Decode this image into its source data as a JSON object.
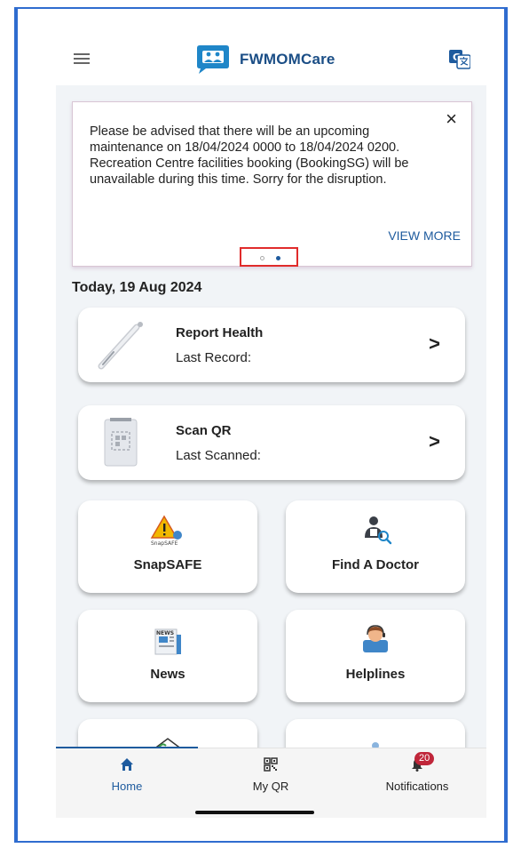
{
  "app": {
    "title": "FWMOMCare"
  },
  "banner": {
    "message": "Please be advised that there will be an upcoming maintenance on 18/04/2024 0000 to 18/04/2024 0200. Recreation Centre facilities booking (BookingSG) will be unavailable during this time. Sorry for the disruption.",
    "close_label": "×",
    "view_more": "VIEW MORE",
    "page_count": 2,
    "active_page": 2
  },
  "date": "Today, 19 Aug 2024",
  "cards": {
    "report_health": {
      "title": "Report Health",
      "subtitle": "Last Record:",
      "icon": "thermometer-icon"
    },
    "scan_qr": {
      "title": "Scan QR",
      "subtitle": "Last Scanned:",
      "icon": "qr-scanner-icon"
    }
  },
  "tiles": {
    "snapsafe": {
      "label": "SnapSAFE",
      "icon_caption": "SnapSAFE",
      "icon": "warning-icon"
    },
    "find_doctor": {
      "label": "Find A Doctor",
      "icon": "doctor-search-icon"
    },
    "news": {
      "label": "News",
      "icon_caption": "NEWS",
      "icon": "newspaper-icon"
    },
    "helplines": {
      "label": "Helplines",
      "icon": "helpline-agent-icon"
    }
  },
  "nav": {
    "home": "Home",
    "my_qr": "My QR",
    "notifications": "Notifications",
    "notification_count": "20"
  },
  "colors": {
    "brand_blue": "#1e5b9e",
    "frame_blue": "#2f6ccf",
    "badge_red": "#c0263a",
    "highlight_red": "#e02b2b"
  }
}
